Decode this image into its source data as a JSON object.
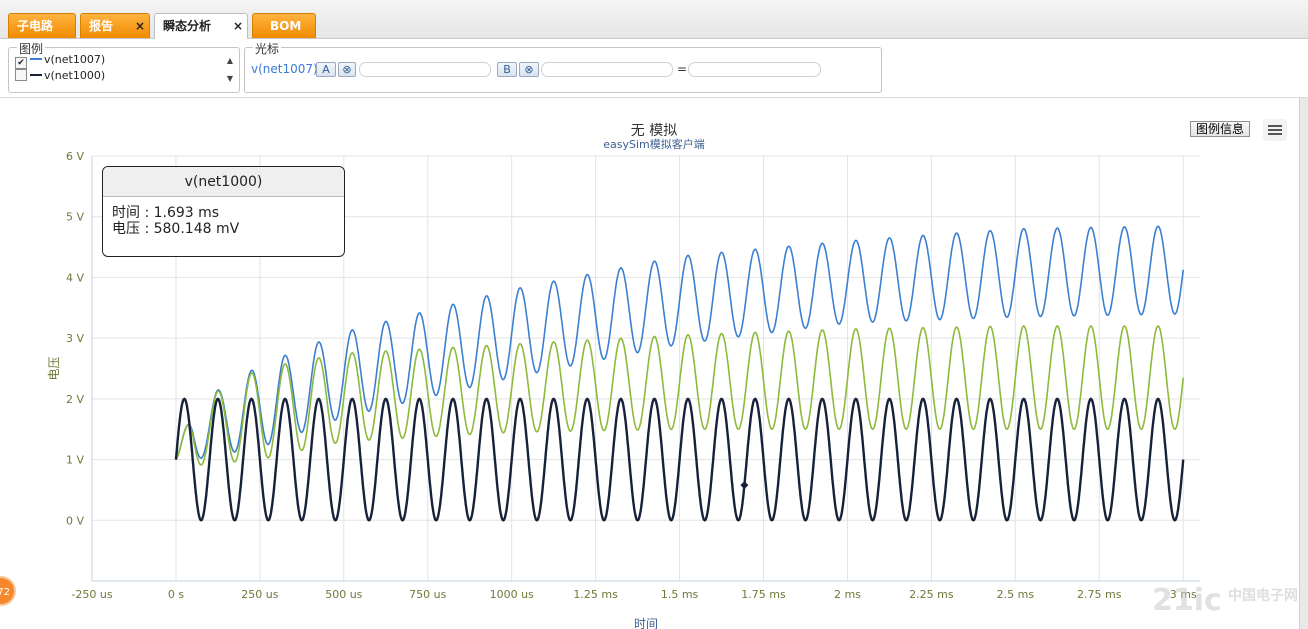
{
  "tabs": [
    {
      "label": "子电路",
      "active": false,
      "closable": false
    },
    {
      "label": "报告",
      "active": false,
      "closable": true
    },
    {
      "label": "瞬态分析",
      "active": true,
      "closable": true
    },
    {
      "label": "BOM",
      "active": false,
      "closable": false
    }
  ],
  "close_glyph": "×",
  "legend_panel": {
    "title": "图例",
    "items": [
      {
        "label": "v(net1007)",
        "checked": true,
        "color": "#3b7fd0"
      },
      {
        "label": "v(net1000)",
        "checked": false,
        "color": "#15223a"
      }
    ],
    "check_glyph": "✔"
  },
  "cursor_panel": {
    "title": "光标",
    "signal": "v(net1007)",
    "a_label": "A",
    "b_label": "B",
    "clear_glyph": "⊗",
    "equals": "="
  },
  "chart": {
    "title": "无 模拟",
    "subtitle": "easySim模拟客户端",
    "legend_info_button": "图例信息",
    "badge_text": "72",
    "watermark": "21ic",
    "watermark2": "中国电子网"
  },
  "tooltip": {
    "series": "v(net1000)",
    "line1": "时间 : 1.693 ms",
    "line2": "电压 : 580.148 mV"
  },
  "chart_data": {
    "type": "line",
    "xlabel": "时间",
    "ylabel": "电压",
    "xlim": [
      -0.25,
      3.05
    ],
    "ylim": [
      -1,
      6
    ],
    "x_ticks": [
      -0.25,
      0,
      0.25,
      0.5,
      0.75,
      1.0,
      1.25,
      1.5,
      1.75,
      2.0,
      2.25,
      2.5,
      2.75,
      3.0
    ],
    "x_tick_labels": [
      "-250 us",
      "0 s",
      "250 us",
      "500 us",
      "750 us",
      "1000 us",
      "1.25 ms",
      "1.5 ms",
      "1.75 ms",
      "2 ms",
      "2.25 ms",
      "2.5 ms",
      "2.75 ms",
      "3 ms"
    ],
    "y_ticks": [
      0,
      1,
      2,
      3,
      4,
      5,
      6
    ],
    "y_tick_labels": [
      "0 V",
      "1 V",
      "2 V",
      "3 V",
      "4 V",
      "5 V",
      "6 V"
    ],
    "grid": true,
    "frequency_khz": 10,
    "series": [
      {
        "name": "v(net1007)",
        "color": "#3b7fd0",
        "x_ms": [
          0,
          0.05,
          0.25,
          0.5,
          1.0,
          1.5,
          2.0,
          2.5,
          3.0
        ],
        "upper": [
          1.0,
          1.9,
          2.55,
          3.1,
          3.8,
          4.35,
          4.6,
          4.8,
          4.85
        ],
        "lower": [
          1.0,
          1.0,
          1.2,
          1.7,
          2.35,
          2.9,
          3.25,
          3.35,
          3.4
        ]
      },
      {
        "name": "v(net1000)",
        "color": "#15223a",
        "x_ms": [
          0,
          3.0
        ],
        "upper": [
          2.0,
          2.0
        ],
        "lower": [
          0.0,
          0.0
        ]
      },
      {
        "color": "#8cba3a",
        "x_ms": [
          0,
          0.05,
          0.25,
          0.5,
          1.0,
          1.5,
          2.0,
          2.5,
          3.0
        ],
        "upper": [
          1.0,
          1.9,
          2.5,
          2.75,
          2.9,
          3.05,
          3.15,
          3.2,
          3.2
        ],
        "lower": [
          1.0,
          0.9,
          1.0,
          1.3,
          1.45,
          1.5,
          1.5,
          1.5,
          1.5
        ]
      }
    ],
    "marker": {
      "series": "v(net1000)",
      "x_ms": 1.693,
      "y": 0.58
    }
  }
}
